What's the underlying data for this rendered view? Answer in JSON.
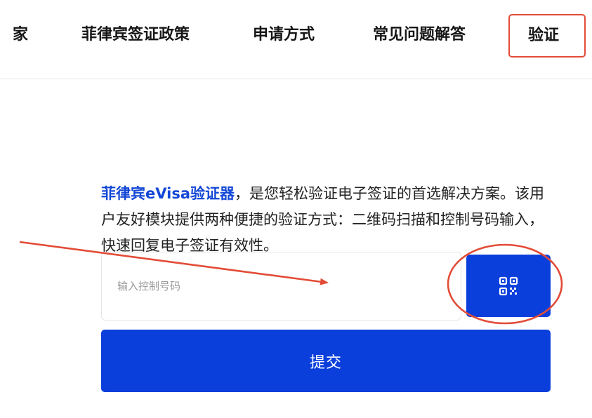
{
  "nav": {
    "items": [
      {
        "label": "家"
      },
      {
        "label": "菲律宾签证政策"
      },
      {
        "label": "申请方式"
      },
      {
        "label": "常见问题解答"
      },
      {
        "label": "验证"
      }
    ]
  },
  "intro": {
    "brand": "菲律宾eVisa验证器",
    "text": "，是您轻松验证电子签证的首选解决方案。该用户友好模块提供两种便捷的验证方式：二维码扫描和控制号码输入，快速回复电子签证有效性。"
  },
  "form": {
    "control_number_placeholder": "输入控制号码",
    "control_number_value": "",
    "qr_button_icon": "qr-code-icon",
    "submit_label": "提交"
  },
  "colors": {
    "accent": "#0a3fdb",
    "brand_text": "#1347d6",
    "annotation": "#e34b37"
  }
}
